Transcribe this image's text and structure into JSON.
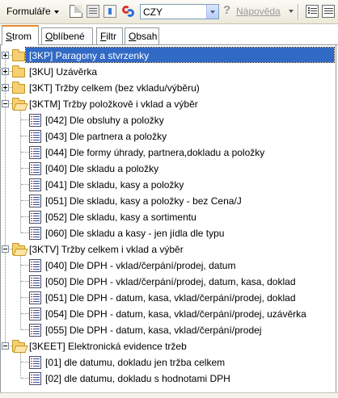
{
  "toolbar": {
    "forms_label": "Formuláře",
    "language_value": "CZY",
    "help_label": "Nápověda",
    "icons": [
      "new-document-icon",
      "properties-icon",
      "export-icon",
      "language-swap-icon",
      "question-icon",
      "list-view-icon",
      "details-view-icon"
    ]
  },
  "tabs": [
    {
      "label": "Strom",
      "underline": "S",
      "rest": "trom",
      "active": true
    },
    {
      "label": "Oblíbené",
      "underline": "O",
      "rest": "blíbené",
      "active": false
    },
    {
      "label": "Filtr",
      "underline": "F",
      "rest": "iltr",
      "active": false
    },
    {
      "label": "Obsah",
      "underline": "O",
      "rest": "bsah",
      "active": false
    }
  ],
  "tree": [
    {
      "level": 0,
      "type": "folder",
      "expanded": false,
      "selected": true,
      "label": "[3KP]  Paragony a stvrzenky"
    },
    {
      "level": 0,
      "type": "folder",
      "expanded": false,
      "selected": false,
      "label": "[3KU]  Uzávěrka"
    },
    {
      "level": 0,
      "type": "folder",
      "expanded": false,
      "selected": false,
      "label": "[3KT]  Tržby celkem (bez vkladu/výběru)"
    },
    {
      "level": 0,
      "type": "folder",
      "expanded": true,
      "selected": false,
      "label": "[3KTM]  Tržby položkově i vklad a výběr"
    },
    {
      "level": 1,
      "type": "report",
      "label": "[042] Dle obsluhy a položky"
    },
    {
      "level": 1,
      "type": "report",
      "label": "[043] Dle partnera a položky"
    },
    {
      "level": 1,
      "type": "report",
      "label": "[044] Dle formy úhrady, partnera,dokladu a položky"
    },
    {
      "level": 1,
      "type": "report",
      "label": "[040] Dle skladu a položky"
    },
    {
      "level": 1,
      "type": "report",
      "label": "[041] Dle skladu, kasy a položky"
    },
    {
      "level": 1,
      "type": "report",
      "label": "[051] Dle skladu, kasy a položky - bez Cena/J"
    },
    {
      "level": 1,
      "type": "report",
      "label": "[052] Dle skladu, kasy a sortimentu"
    },
    {
      "level": 1,
      "type": "report",
      "label": "[060] Dle skladu a kasy - jen jídla dle typu"
    },
    {
      "level": 0,
      "type": "folder",
      "expanded": true,
      "selected": false,
      "label": "[3KTV]  Tržby celkem i vklad a výběr"
    },
    {
      "level": 1,
      "type": "report",
      "label": "[040] Dle DPH - vklad/čerpání/prodej, datum"
    },
    {
      "level": 1,
      "type": "report",
      "label": "[050] Dle DPH - vklad/čerpání/prodej, datum, kasa, doklad"
    },
    {
      "level": 1,
      "type": "report",
      "label": "[051] Dle DPH - datum, kasa, vklad/čerpání/prodej, doklad"
    },
    {
      "level": 1,
      "type": "report",
      "label": "[054] Dle DPH - datum, kasa, vklad/čerpání/prodej, uzávěrka"
    },
    {
      "level": 1,
      "type": "report",
      "label": "[055] Dle DPH - datum, kasa, vklad/čerpání/prodej"
    },
    {
      "level": 0,
      "type": "folder",
      "expanded": true,
      "selected": false,
      "label": "[3KEET]  Elektronická evidence tržeb"
    },
    {
      "level": 1,
      "type": "report",
      "label": "[01] dle datumu, dokladu jen tržba celkem"
    },
    {
      "level": 1,
      "type": "report",
      "label": "[02] dle datumu, dokladu s hodnotami DPH"
    }
  ],
  "colors": {
    "selection": "#316ac5",
    "active_tab_accent": "#e68b2c",
    "folder": "#f5d073"
  }
}
